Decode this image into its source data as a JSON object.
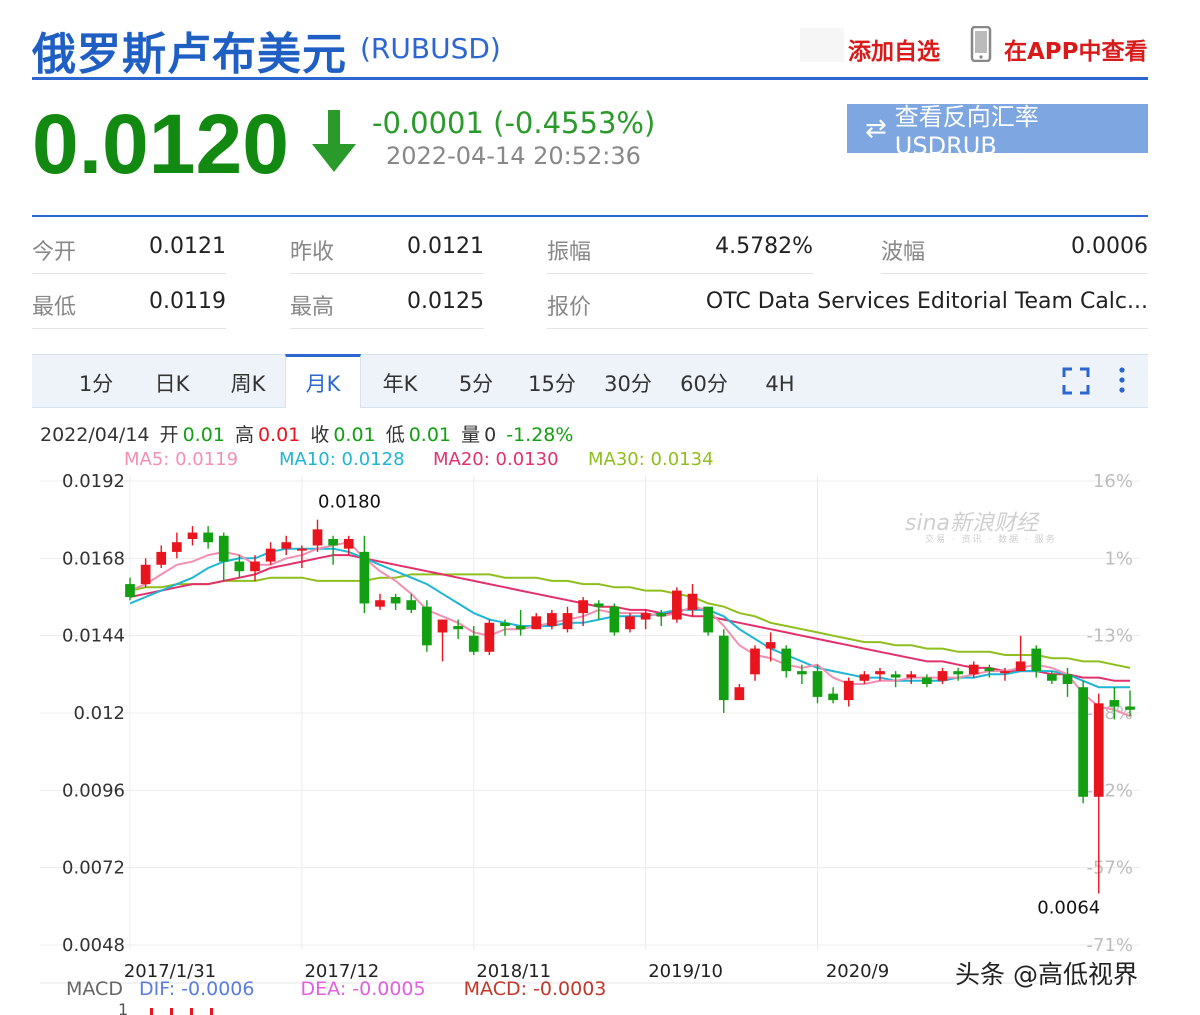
{
  "header": {
    "title": "俄罗斯卢布美元",
    "code": "(RUBUSD)",
    "add_favorite": "添加自选",
    "view_in_app": "在APP中查看"
  },
  "quote": {
    "price": "0.0120",
    "change": "-0.0001 (-0.4553%)",
    "timestamp": "2022-04-14 20:52:36",
    "reverse_button": "查看反向汇率 USDRUB",
    "price_color": "#128a12"
  },
  "stats": [
    {
      "label": "今开",
      "value": "0.0121"
    },
    {
      "label": "昨收",
      "value": "0.0121"
    },
    {
      "label": "振幅",
      "value": "4.5782%"
    },
    {
      "label": "波幅",
      "value": "0.0006"
    },
    {
      "label": "最低",
      "value": "0.0119"
    },
    {
      "label": "最高",
      "value": "0.0125"
    },
    {
      "label": "报价",
      "value": "OTC Data Services Editorial Team Calc..."
    }
  ],
  "tabs": [
    {
      "label": "1分"
    },
    {
      "label": "日K"
    },
    {
      "label": "周K"
    },
    {
      "label": "月K",
      "active": true
    },
    {
      "label": "年K"
    },
    {
      "label": "5分"
    },
    {
      "label": "15分"
    },
    {
      "label": "30分"
    },
    {
      "label": "60分"
    },
    {
      "label": "4H"
    }
  ],
  "infoline": {
    "date": "2022/04/14",
    "open_label": "开",
    "open": "0.01",
    "high_label": "高",
    "high": "0.01",
    "close_label": "收",
    "close": "0.01",
    "low_label": "低",
    "low": "0.01",
    "vol_label": "量",
    "vol": "0",
    "pct": "-1.28%"
  },
  "ma_legend": {
    "ma5": "MA5: 0.0119",
    "ma10": "MA10: 0.0128",
    "ma20": "MA20: 0.0130",
    "ma30": "MA30: 0.0134"
  },
  "colors": {
    "up": "#e8141e",
    "down": "#12a012",
    "ma5": "#f48fb1",
    "ma10": "#1fb5d6",
    "ma20": "#e3316b",
    "ma30": "#8fbf1f",
    "accent": "#2c67d1"
  },
  "watermark": {
    "text": "sina新浪财经",
    "sub": "交易 · 资讯 · 数据 · 服务"
  },
  "macd": {
    "label": "MACD",
    "dif": "DIF: -0.0006",
    "dea": "DEA: -0.0005",
    "macd": "MACD: -0.0003",
    "axis_top": "1"
  },
  "credit": "头条 @高低视界",
  "chart_data": {
    "type": "candlestick",
    "y_ticks": [
      "0.0192",
      "0.0168",
      "0.0144",
      "0.012",
      "0.0096",
      "0.0072",
      "0.0048"
    ],
    "y_values": [
      0.0192,
      0.0168,
      0.0144,
      0.012,
      0.0096,
      0.0072,
      0.0048
    ],
    "pct_ticks": [
      "16%",
      "1%",
      "-13%",
      "-28%",
      "-42%",
      "-57%",
      "-71%"
    ],
    "x_ticks": [
      "2017/1/31",
      "2017/12",
      "2018/11",
      "2019/10",
      "2020/9"
    ],
    "x_tick_index": [
      0,
      11,
      22,
      33,
      44
    ],
    "ylim": [
      0.0048,
      0.0192
    ],
    "annotations": [
      {
        "text": "0.0180",
        "index": 12,
        "value": 0.018
      },
      {
        "text": "0.0064",
        "index": 62,
        "value": 0.0064
      }
    ],
    "candles": [
      [
        0.016,
        0.0156,
        0.0162,
        0.0155
      ],
      [
        0.016,
        0.0166,
        0.0168,
        0.0159
      ],
      [
        0.0166,
        0.017,
        0.0172,
        0.0165
      ],
      [
        0.017,
        0.0173,
        0.0176,
        0.0168
      ],
      [
        0.0174,
        0.0176,
        0.0178,
        0.0172
      ],
      [
        0.0176,
        0.0173,
        0.0178,
        0.0171
      ],
      [
        0.0175,
        0.0167,
        0.0176,
        0.0161
      ],
      [
        0.0167,
        0.0164,
        0.0169,
        0.0162
      ],
      [
        0.0164,
        0.0167,
        0.0169,
        0.0161
      ],
      [
        0.0167,
        0.0171,
        0.0173,
        0.0166
      ],
      [
        0.0171,
        0.0173,
        0.0175,
        0.0169
      ],
      [
        0.0171,
        0.0171,
        0.0172,
        0.0165
      ],
      [
        0.0172,
        0.0177,
        0.018,
        0.017
      ],
      [
        0.0174,
        0.0172,
        0.0175,
        0.0166
      ],
      [
        0.0171,
        0.0174,
        0.0175,
        0.0169
      ],
      [
        0.017,
        0.0154,
        0.0175,
        0.0151
      ],
      [
        0.0153,
        0.0155,
        0.0157,
        0.0152
      ],
      [
        0.0156,
        0.0154,
        0.0157,
        0.0152
      ],
      [
        0.0155,
        0.0152,
        0.0157,
        0.0151
      ],
      [
        0.0153,
        0.0141,
        0.0155,
        0.0139
      ],
      [
        0.0145,
        0.0149,
        0.0149,
        0.0136
      ],
      [
        0.0147,
        0.0146,
        0.0149,
        0.0143
      ],
      [
        0.0144,
        0.0139,
        0.0147,
        0.0138
      ],
      [
        0.0139,
        0.0148,
        0.0149,
        0.0138
      ],
      [
        0.0148,
        0.0147,
        0.0149,
        0.0144
      ],
      [
        0.0147,
        0.0146,
        0.0152,
        0.0144
      ],
      [
        0.0146,
        0.015,
        0.0151,
        0.0146
      ],
      [
        0.0147,
        0.0151,
        0.0152,
        0.0146
      ],
      [
        0.0146,
        0.0151,
        0.0153,
        0.0145
      ],
      [
        0.0151,
        0.0155,
        0.0156,
        0.0147
      ],
      [
        0.0154,
        0.0153,
        0.0155,
        0.0149
      ],
      [
        0.0153,
        0.0145,
        0.0154,
        0.0144
      ],
      [
        0.0146,
        0.015,
        0.0151,
        0.0145
      ],
      [
        0.0149,
        0.0151,
        0.0152,
        0.0146
      ],
      [
        0.0151,
        0.015,
        0.0152,
        0.0147
      ],
      [
        0.0149,
        0.0158,
        0.0159,
        0.0148
      ],
      [
        0.0152,
        0.0157,
        0.016,
        0.015
      ],
      [
        0.0153,
        0.0145,
        0.0153,
        0.0144
      ],
      [
        0.0144,
        0.0124,
        0.0146,
        0.012
      ],
      [
        0.0124,
        0.0128,
        0.0129,
        0.0125
      ],
      [
        0.0132,
        0.014,
        0.0141,
        0.013
      ],
      [
        0.014,
        0.0142,
        0.0145,
        0.0136
      ],
      [
        0.014,
        0.0133,
        0.0141,
        0.0131
      ],
      [
        0.0133,
        0.0132,
        0.0135,
        0.0129
      ],
      [
        0.0133,
        0.0125,
        0.0135,
        0.0123
      ],
      [
        0.0126,
        0.0124,
        0.0128,
        0.0123
      ],
      [
        0.0124,
        0.013,
        0.0131,
        0.0122
      ],
      [
        0.013,
        0.0132,
        0.0133,
        0.0129
      ],
      [
        0.0132,
        0.0133,
        0.0134,
        0.013
      ],
      [
        0.0132,
        0.0131,
        0.0133,
        0.0128
      ],
      [
        0.0131,
        0.0132,
        0.0133,
        0.0129
      ],
      [
        0.0131,
        0.0129,
        0.0132,
        0.0128
      ],
      [
        0.013,
        0.0133,
        0.0134,
        0.0129
      ],
      [
        0.0133,
        0.0132,
        0.0134,
        0.013
      ],
      [
        0.0132,
        0.0135,
        0.0136,
        0.0131
      ],
      [
        0.0134,
        0.0133,
        0.0135,
        0.0131
      ],
      [
        0.0133,
        0.0133,
        0.0134,
        0.013
      ],
      [
        0.0133,
        0.0136,
        0.0144,
        0.0133
      ],
      [
        0.014,
        0.0133,
        0.0141,
        0.0131
      ],
      [
        0.0132,
        0.013,
        0.0133,
        0.0129
      ],
      [
        0.0132,
        0.0129,
        0.0134,
        0.0125
      ],
      [
        0.0128,
        0.0094,
        0.013,
        0.0092
      ],
      [
        0.0094,
        0.0123,
        0.0126,
        0.0064
      ],
      [
        0.0124,
        0.0122,
        0.0128,
        0.0118
      ],
      [
        0.0122,
        0.0121,
        0.0127,
        0.0119
      ]
    ],
    "ma": [
      {
        "name": "MA5",
        "values": [
          0.0158,
          0.016,
          0.0163,
          0.0166,
          0.0167,
          0.0169,
          0.017,
          0.0169,
          0.0166,
          0.0166,
          0.0168,
          0.0169,
          0.0171,
          0.0172,
          0.0173,
          0.0168,
          0.0164,
          0.0161,
          0.0157,
          0.0152,
          0.015,
          0.0148,
          0.0145,
          0.0144,
          0.0146,
          0.0146,
          0.0147,
          0.0148,
          0.0149,
          0.015,
          0.0152,
          0.0151,
          0.0151,
          0.0151,
          0.015,
          0.0151,
          0.0153,
          0.0152,
          0.0147,
          0.0141,
          0.0138,
          0.0137,
          0.0135,
          0.0134,
          0.0135,
          0.0131,
          0.0129,
          0.0129,
          0.013,
          0.013,
          0.0131,
          0.0131,
          0.0131,
          0.0131,
          0.0132,
          0.0133,
          0.0133,
          0.0134,
          0.0135,
          0.0134,
          0.0132,
          0.0126,
          0.0122,
          0.0121,
          0.0119
        ]
      },
      {
        "name": "MA10",
        "values": [
          0.0154,
          0.0156,
          0.0158,
          0.016,
          0.0162,
          0.0165,
          0.0167,
          0.0168,
          0.0168,
          0.017,
          0.0171,
          0.0171,
          0.0171,
          0.0171,
          0.017,
          0.0168,
          0.0166,
          0.0164,
          0.0162,
          0.016,
          0.0157,
          0.0154,
          0.0151,
          0.0149,
          0.0148,
          0.0147,
          0.0147,
          0.0147,
          0.0148,
          0.0148,
          0.0149,
          0.015,
          0.015,
          0.015,
          0.0151,
          0.0152,
          0.0152,
          0.0152,
          0.015,
          0.0146,
          0.0143,
          0.014,
          0.0138,
          0.0136,
          0.0134,
          0.0133,
          0.0132,
          0.0131,
          0.0131,
          0.013,
          0.013,
          0.013,
          0.013,
          0.0131,
          0.0131,
          0.0132,
          0.0132,
          0.0133,
          0.0133,
          0.0133,
          0.0132,
          0.013,
          0.0128,
          0.0128,
          0.0128
        ]
      },
      {
        "name": "MA20",
        "values": [
          0.0156,
          0.0157,
          0.0158,
          0.0159,
          0.016,
          0.016,
          0.0161,
          0.0162,
          0.0163,
          0.0165,
          0.0166,
          0.0167,
          0.0168,
          0.0169,
          0.0169,
          0.0168,
          0.0167,
          0.0166,
          0.0165,
          0.0164,
          0.0163,
          0.0162,
          0.0161,
          0.016,
          0.0159,
          0.0158,
          0.0157,
          0.0156,
          0.0155,
          0.0154,
          0.0153,
          0.0153,
          0.0152,
          0.0152,
          0.0151,
          0.0151,
          0.015,
          0.015,
          0.0149,
          0.0148,
          0.0147,
          0.0146,
          0.0145,
          0.0144,
          0.0143,
          0.0142,
          0.0141,
          0.014,
          0.0139,
          0.0138,
          0.0137,
          0.0136,
          0.0136,
          0.0135,
          0.0134,
          0.0134,
          0.0133,
          0.0133,
          0.0133,
          0.0132,
          0.0132,
          0.0131,
          0.0131,
          0.013,
          0.013
        ]
      },
      {
        "name": "MA30",
        "values": [
          0.0158,
          0.0159,
          0.0159,
          0.016,
          0.016,
          0.016,
          0.0161,
          0.0161,
          0.0161,
          0.0162,
          0.0162,
          0.0162,
          0.0161,
          0.0161,
          0.0161,
          0.0161,
          0.0162,
          0.0162,
          0.0163,
          0.0163,
          0.0163,
          0.0163,
          0.0163,
          0.0163,
          0.0162,
          0.0162,
          0.0162,
          0.0161,
          0.0161,
          0.016,
          0.016,
          0.0159,
          0.0159,
          0.0158,
          0.0158,
          0.0157,
          0.0156,
          0.0154,
          0.0153,
          0.0151,
          0.015,
          0.0148,
          0.0147,
          0.0146,
          0.0145,
          0.0144,
          0.0143,
          0.0142,
          0.0142,
          0.0141,
          0.0141,
          0.014,
          0.014,
          0.0139,
          0.0139,
          0.0139,
          0.0138,
          0.0138,
          0.0138,
          0.0137,
          0.0137,
          0.0136,
          0.0136,
          0.0135,
          0.0134
        ]
      }
    ]
  }
}
